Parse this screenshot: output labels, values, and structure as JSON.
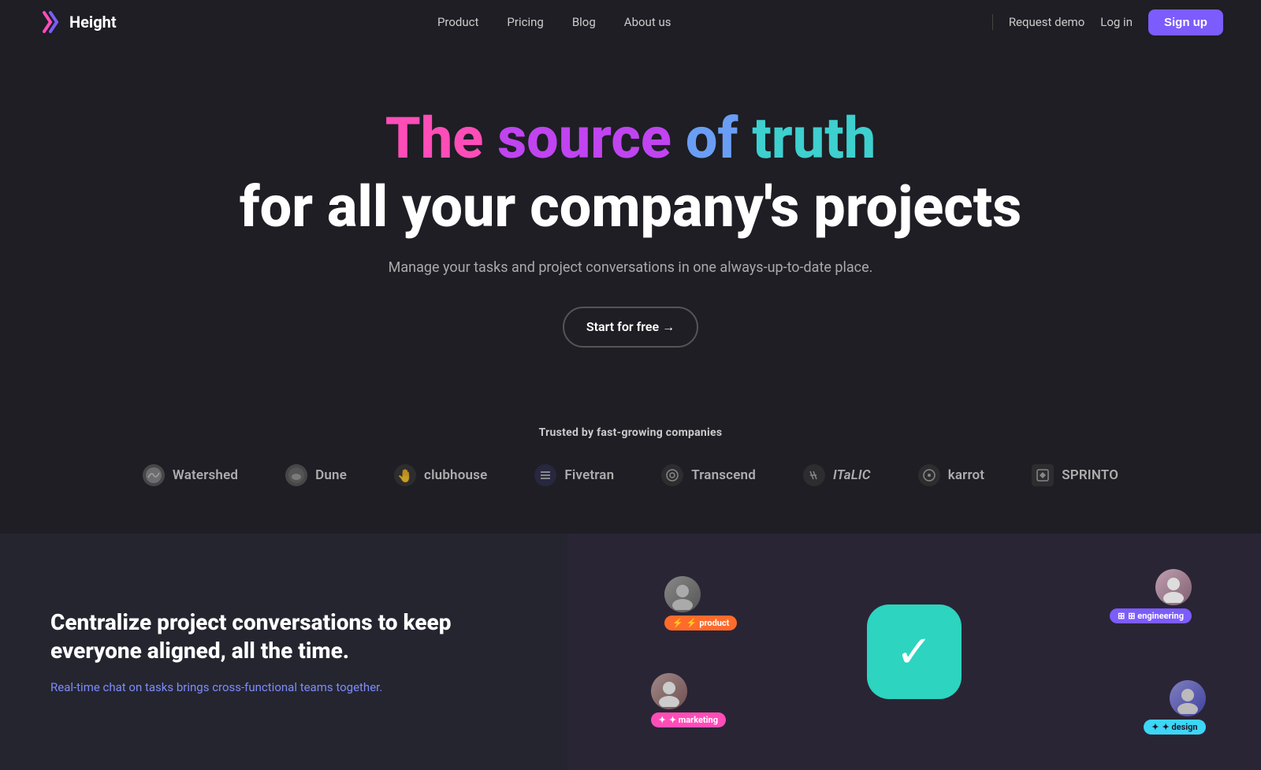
{
  "nav": {
    "logo_text": "Height",
    "links": [
      {
        "label": "Product",
        "id": "product"
      },
      {
        "label": "Pricing",
        "id": "pricing"
      },
      {
        "label": "Blog",
        "id": "blog"
      },
      {
        "label": "About us",
        "id": "about"
      }
    ],
    "request_demo": "Request demo",
    "login": "Log in",
    "signup": "Sign up"
  },
  "hero": {
    "title_line1_the": "The",
    "title_line1_source": "source",
    "title_line1_of": "of",
    "title_line1_truth": "truth",
    "title_line2": "for all your company's projects",
    "subtitle": "Manage your tasks and project conversations in one always-up-to-date place.",
    "cta": "Start for free →"
  },
  "trusted": {
    "label": "Trusted by fast-growing companies",
    "companies": [
      {
        "name": "Watershed",
        "icon": "🌊"
      },
      {
        "name": "Dune",
        "icon": "🏜"
      },
      {
        "name": "clubhouse",
        "icon": "🤚"
      },
      {
        "name": "Fivetran",
        "icon": "⚡"
      },
      {
        "name": "Transcend",
        "icon": "⚙️"
      },
      {
        "name": "ITaLIC",
        "icon": "✳️"
      },
      {
        "name": "karrot",
        "icon": "⊙"
      },
      {
        "name": "SPRINTO",
        "icon": "▣"
      }
    ]
  },
  "feature": {
    "title": "Centralize project conversations to keep everyone aligned, all the time.",
    "subtitle": "Real-time chat on tasks brings cross-functional teams together.",
    "tags": {
      "product": "⚡ product",
      "engineering": "⊞ engineering",
      "marketing": "✦ marketing",
      "design": "✦ design"
    }
  }
}
